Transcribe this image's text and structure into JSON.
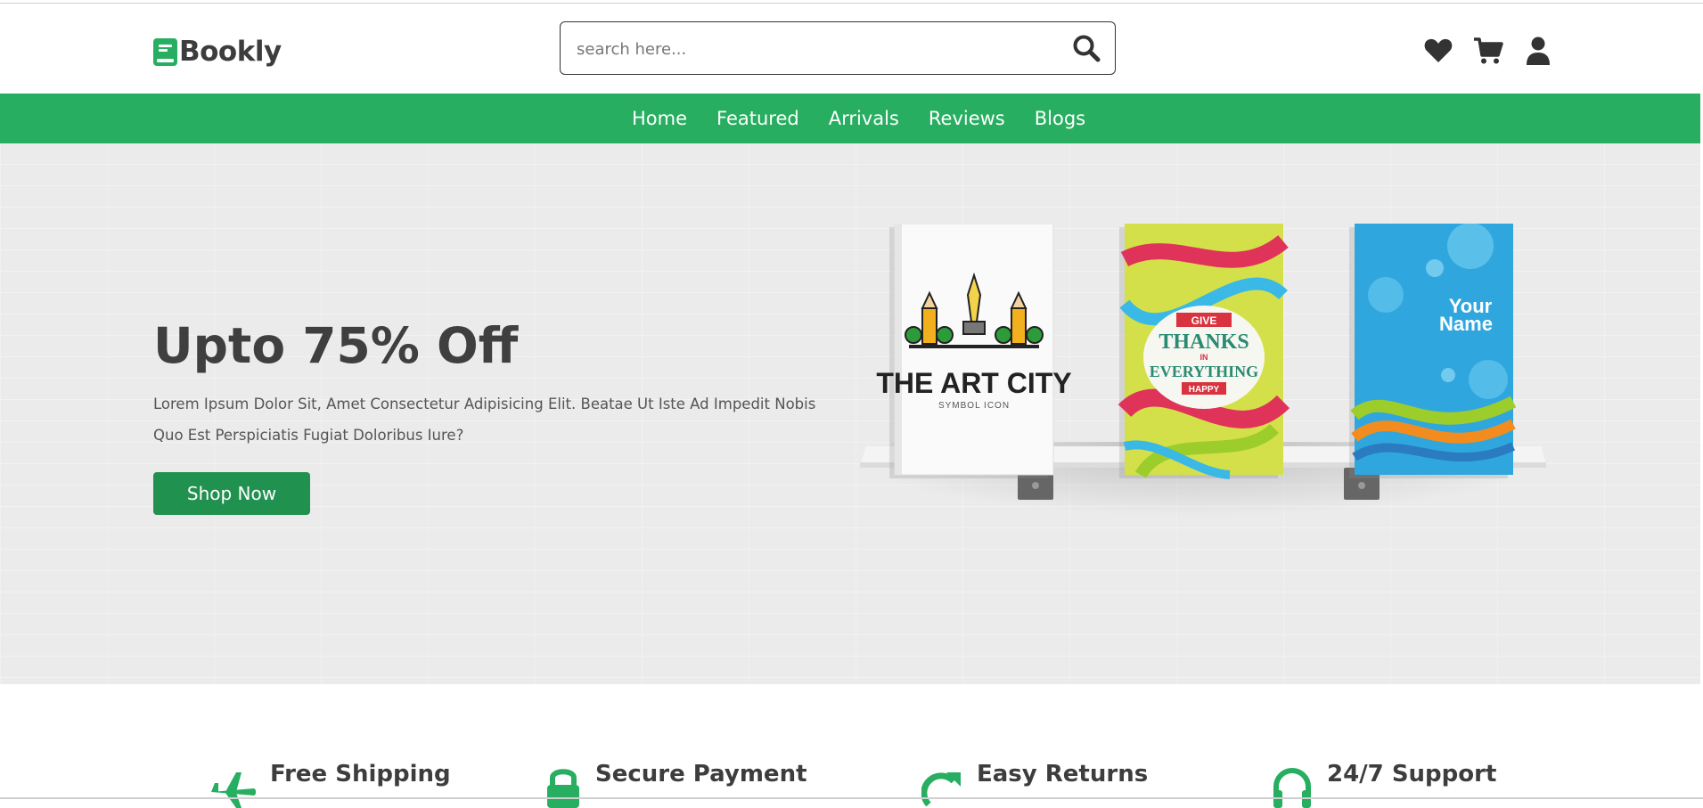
{
  "header": {
    "logo_text": "Bookly",
    "logo_icon": "book-icon",
    "search": {
      "placeholder": "search here...",
      "value": ""
    },
    "icons": [
      "heart-icon",
      "cart-icon",
      "user-icon"
    ]
  },
  "nav": {
    "links": [
      {
        "label": "Home"
      },
      {
        "label": "Featured"
      },
      {
        "label": "Arrivals"
      },
      {
        "label": "Reviews"
      },
      {
        "label": "Blogs"
      }
    ]
  },
  "hero": {
    "title": "Upto 75% Off",
    "description": "Lorem Ipsum Dolor Sit, Amet Consectetur Adipisicing Elit. Beatae Ut Iste Ad Impedit Nobis Quo Est Perspiciatis Fugiat Doloribus Iure?",
    "button_label": "Shop Now",
    "books": [
      {
        "title": "THE ART CITY",
        "subtitle": "SYMBOL ICON"
      },
      {
        "lines": [
          "GIVE",
          "THANKS",
          "IN",
          "EVERYTHING",
          "HAPPY"
        ]
      },
      {
        "lines": [
          "Your",
          "Name"
        ]
      }
    ]
  },
  "features": [
    {
      "icon": "plane-icon",
      "title": "Free Shipping"
    },
    {
      "icon": "lock-icon",
      "title": "Secure Payment"
    },
    {
      "icon": "redo-icon",
      "title": "Easy Returns"
    },
    {
      "icon": "headset-icon",
      "title": "24/7 Support"
    }
  ],
  "colors": {
    "brand": "#27ae60",
    "button": "#219150",
    "text": "#3d3d3d"
  }
}
